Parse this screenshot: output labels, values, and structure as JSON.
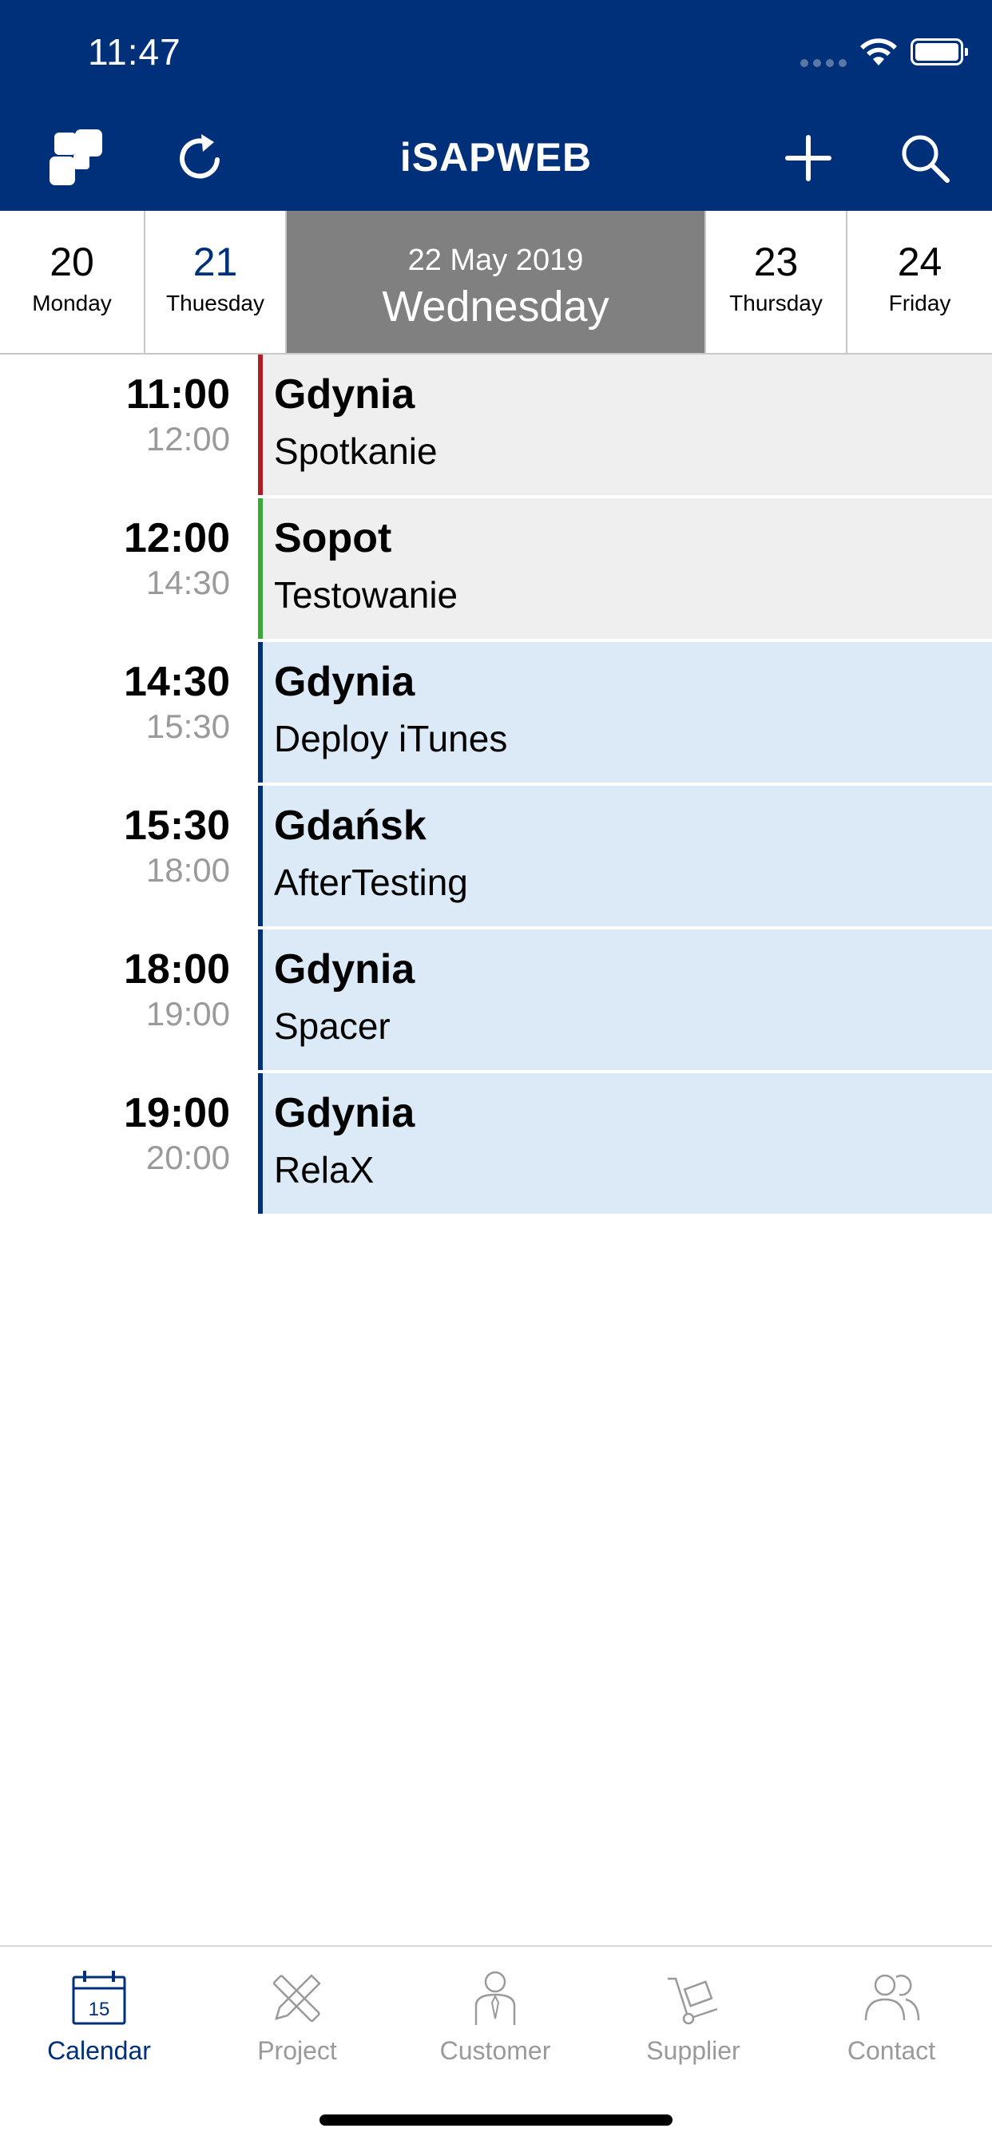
{
  "status_bar": {
    "time": "11:47"
  },
  "header": {
    "title": "iSAPWEB"
  },
  "day_strip": {
    "days": [
      {
        "num": "20",
        "name": "Monday"
      },
      {
        "num": "21",
        "name": "Thuesday"
      },
      {
        "date": "22 May 2019",
        "name": "Wednesday"
      },
      {
        "num": "23",
        "name": "Thursday"
      },
      {
        "num": "24",
        "name": "Friday"
      }
    ]
  },
  "events": [
    {
      "start": "11:00",
      "end": "12:00",
      "location": "Gdynia",
      "title": "Spotkanie",
      "color": "#b01e23"
    },
    {
      "start": "12:00",
      "end": "14:30",
      "location": "Sopot",
      "title": "Testowanie",
      "color": "#3aa935"
    },
    {
      "start": "14:30",
      "end": "15:30",
      "location": "Gdynia",
      "title": "Deploy iTunes",
      "color": "#00307a"
    },
    {
      "start": "15:30",
      "end": "18:00",
      "location": "Gdańsk",
      "title": "AfterTesting",
      "color": "#00307a"
    },
    {
      "start": "18:00",
      "end": "19:00",
      "location": "Gdynia",
      "title": "Spacer",
      "color": "#00307a"
    },
    {
      "start": "19:00",
      "end": "20:00",
      "location": "Gdynia",
      "title": "RelaX",
      "color": "#00307a"
    }
  ],
  "tabbar": {
    "tabs": [
      {
        "label": "Calendar",
        "icon": "calendar-icon",
        "icon_text": "15",
        "active": true
      },
      {
        "label": "Project",
        "icon": "ruler-pencil-icon"
      },
      {
        "label": "Customer",
        "icon": "person-icon"
      },
      {
        "label": "Supplier",
        "icon": "hand-truck-icon"
      },
      {
        "label": "Contact",
        "icon": "people-icon"
      }
    ]
  },
  "colors": {
    "brand": "#00307a",
    "selected_day": "#808080",
    "card_gray": "#efefef",
    "card_blue": "#dce9f7"
  }
}
